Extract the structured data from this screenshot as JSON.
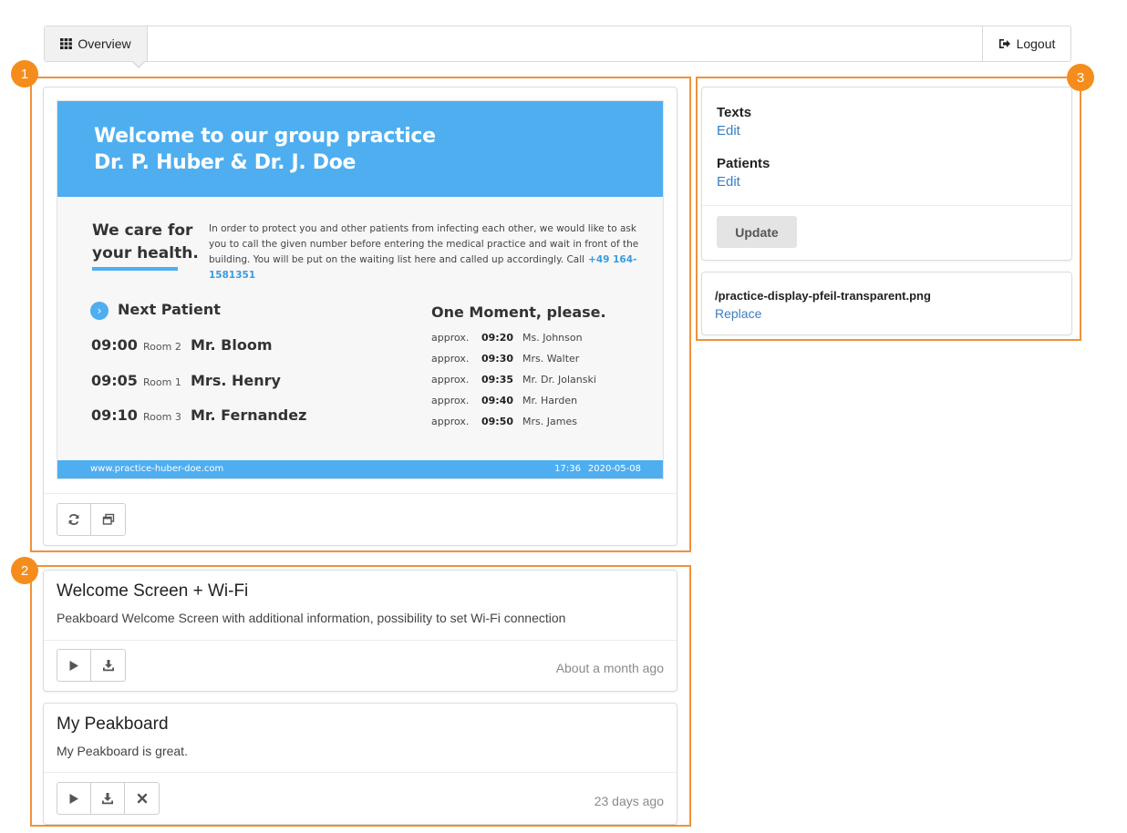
{
  "nav": {
    "overview_label": "Overview",
    "logout_label": "Logout"
  },
  "badges": [
    "1",
    "2",
    "3"
  ],
  "preview": {
    "title_line1": "Welcome to our group practice",
    "title_line2": "Dr. P. Huber & Dr. J. Doe",
    "care_line1": "We care for",
    "care_line2": "your health.",
    "info_text": "In order to protect you and other patients from infecting each other, we would like to ask you to call the given number before entering the medical practice and wait in front of the building. You will be put on the waiting list here and called up accordingly.  Call",
    "phone": "+49 164-1581351",
    "next_title": "Next Patient",
    "appointments": [
      {
        "time": "09:00",
        "room": "Room 2",
        "name": "Mr. Bloom"
      },
      {
        "time": "09:05",
        "room": "Room 1",
        "name": "Mrs. Henry"
      },
      {
        "time": "09:10",
        "room": "Room 3",
        "name": "Mr. Fernandez"
      }
    ],
    "moment_title": "One Moment, please.",
    "waiting": [
      {
        "approx": "approx.",
        "time": "09:20",
        "name": "Ms. Johnson"
      },
      {
        "approx": "approx.",
        "time": "09:30",
        "name": "Mrs. Walter"
      },
      {
        "approx": "approx.",
        "time": "09:35",
        "name": "Mr. Dr. Jolanski"
      },
      {
        "approx": "approx.",
        "time": "09:40",
        "name": "Mr. Harden"
      },
      {
        "approx": "approx.",
        "time": "09:50",
        "name": "Mrs. James"
      }
    ],
    "footer_url": "www.practice-huber-doe.com",
    "footer_time": "17:36",
    "footer_date": "2020-05-08"
  },
  "boards": [
    {
      "title": "Welcome Screen + Wi-Fi",
      "description": "Peakboard Welcome Screen with additional information, possibility to set Wi-Fi connection",
      "time": "About a month ago"
    },
    {
      "title": "My Peakboard",
      "description": "My Peakboard is great.",
      "time": "23 days ago"
    }
  ],
  "side": {
    "texts_label": "Texts",
    "texts_edit": "Edit",
    "patients_label": "Patients",
    "patients_edit": "Edit",
    "update_label": "Update",
    "file_name": "/practice-display-pfeil-transparent.png",
    "replace_label": "Replace"
  },
  "colors": {
    "highlight": "#f0923a",
    "preview_blue": "#4eaef0",
    "link": "#3a7fc1"
  }
}
